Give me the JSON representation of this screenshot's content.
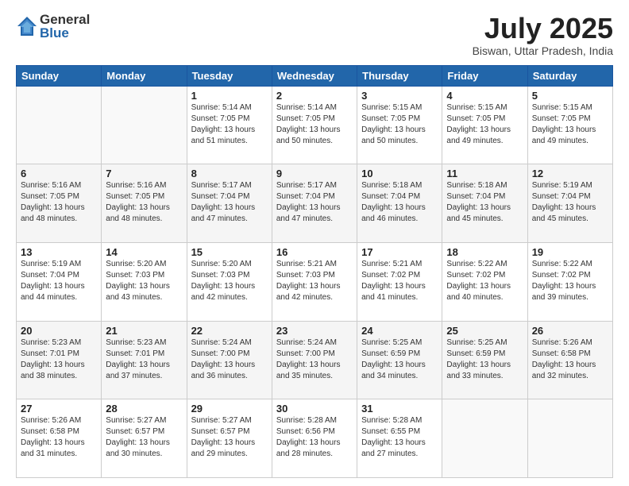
{
  "header": {
    "logo_general": "General",
    "logo_blue": "Blue",
    "month_title": "July 2025",
    "location": "Biswan, Uttar Pradesh, India"
  },
  "days_of_week": [
    "Sunday",
    "Monday",
    "Tuesday",
    "Wednesday",
    "Thursday",
    "Friday",
    "Saturday"
  ],
  "weeks": [
    [
      {
        "day": "",
        "info": ""
      },
      {
        "day": "",
        "info": ""
      },
      {
        "day": "1",
        "info": "Sunrise: 5:14 AM\nSunset: 7:05 PM\nDaylight: 13 hours\nand 51 minutes."
      },
      {
        "day": "2",
        "info": "Sunrise: 5:14 AM\nSunset: 7:05 PM\nDaylight: 13 hours\nand 50 minutes."
      },
      {
        "day": "3",
        "info": "Sunrise: 5:15 AM\nSunset: 7:05 PM\nDaylight: 13 hours\nand 50 minutes."
      },
      {
        "day": "4",
        "info": "Sunrise: 5:15 AM\nSunset: 7:05 PM\nDaylight: 13 hours\nand 49 minutes."
      },
      {
        "day": "5",
        "info": "Sunrise: 5:15 AM\nSunset: 7:05 PM\nDaylight: 13 hours\nand 49 minutes."
      }
    ],
    [
      {
        "day": "6",
        "info": "Sunrise: 5:16 AM\nSunset: 7:05 PM\nDaylight: 13 hours\nand 48 minutes."
      },
      {
        "day": "7",
        "info": "Sunrise: 5:16 AM\nSunset: 7:05 PM\nDaylight: 13 hours\nand 48 minutes."
      },
      {
        "day": "8",
        "info": "Sunrise: 5:17 AM\nSunset: 7:04 PM\nDaylight: 13 hours\nand 47 minutes."
      },
      {
        "day": "9",
        "info": "Sunrise: 5:17 AM\nSunset: 7:04 PM\nDaylight: 13 hours\nand 47 minutes."
      },
      {
        "day": "10",
        "info": "Sunrise: 5:18 AM\nSunset: 7:04 PM\nDaylight: 13 hours\nand 46 minutes."
      },
      {
        "day": "11",
        "info": "Sunrise: 5:18 AM\nSunset: 7:04 PM\nDaylight: 13 hours\nand 45 minutes."
      },
      {
        "day": "12",
        "info": "Sunrise: 5:19 AM\nSunset: 7:04 PM\nDaylight: 13 hours\nand 45 minutes."
      }
    ],
    [
      {
        "day": "13",
        "info": "Sunrise: 5:19 AM\nSunset: 7:04 PM\nDaylight: 13 hours\nand 44 minutes."
      },
      {
        "day": "14",
        "info": "Sunrise: 5:20 AM\nSunset: 7:03 PM\nDaylight: 13 hours\nand 43 minutes."
      },
      {
        "day": "15",
        "info": "Sunrise: 5:20 AM\nSunset: 7:03 PM\nDaylight: 13 hours\nand 42 minutes."
      },
      {
        "day": "16",
        "info": "Sunrise: 5:21 AM\nSunset: 7:03 PM\nDaylight: 13 hours\nand 42 minutes."
      },
      {
        "day": "17",
        "info": "Sunrise: 5:21 AM\nSunset: 7:02 PM\nDaylight: 13 hours\nand 41 minutes."
      },
      {
        "day": "18",
        "info": "Sunrise: 5:22 AM\nSunset: 7:02 PM\nDaylight: 13 hours\nand 40 minutes."
      },
      {
        "day": "19",
        "info": "Sunrise: 5:22 AM\nSunset: 7:02 PM\nDaylight: 13 hours\nand 39 minutes."
      }
    ],
    [
      {
        "day": "20",
        "info": "Sunrise: 5:23 AM\nSunset: 7:01 PM\nDaylight: 13 hours\nand 38 minutes."
      },
      {
        "day": "21",
        "info": "Sunrise: 5:23 AM\nSunset: 7:01 PM\nDaylight: 13 hours\nand 37 minutes."
      },
      {
        "day": "22",
        "info": "Sunrise: 5:24 AM\nSunset: 7:00 PM\nDaylight: 13 hours\nand 36 minutes."
      },
      {
        "day": "23",
        "info": "Sunrise: 5:24 AM\nSunset: 7:00 PM\nDaylight: 13 hours\nand 35 minutes."
      },
      {
        "day": "24",
        "info": "Sunrise: 5:25 AM\nSunset: 6:59 PM\nDaylight: 13 hours\nand 34 minutes."
      },
      {
        "day": "25",
        "info": "Sunrise: 5:25 AM\nSunset: 6:59 PM\nDaylight: 13 hours\nand 33 minutes."
      },
      {
        "day": "26",
        "info": "Sunrise: 5:26 AM\nSunset: 6:58 PM\nDaylight: 13 hours\nand 32 minutes."
      }
    ],
    [
      {
        "day": "27",
        "info": "Sunrise: 5:26 AM\nSunset: 6:58 PM\nDaylight: 13 hours\nand 31 minutes."
      },
      {
        "day": "28",
        "info": "Sunrise: 5:27 AM\nSunset: 6:57 PM\nDaylight: 13 hours\nand 30 minutes."
      },
      {
        "day": "29",
        "info": "Sunrise: 5:27 AM\nSunset: 6:57 PM\nDaylight: 13 hours\nand 29 minutes."
      },
      {
        "day": "30",
        "info": "Sunrise: 5:28 AM\nSunset: 6:56 PM\nDaylight: 13 hours\nand 28 minutes."
      },
      {
        "day": "31",
        "info": "Sunrise: 5:28 AM\nSunset: 6:55 PM\nDaylight: 13 hours\nand 27 minutes."
      },
      {
        "day": "",
        "info": ""
      },
      {
        "day": "",
        "info": ""
      }
    ]
  ]
}
